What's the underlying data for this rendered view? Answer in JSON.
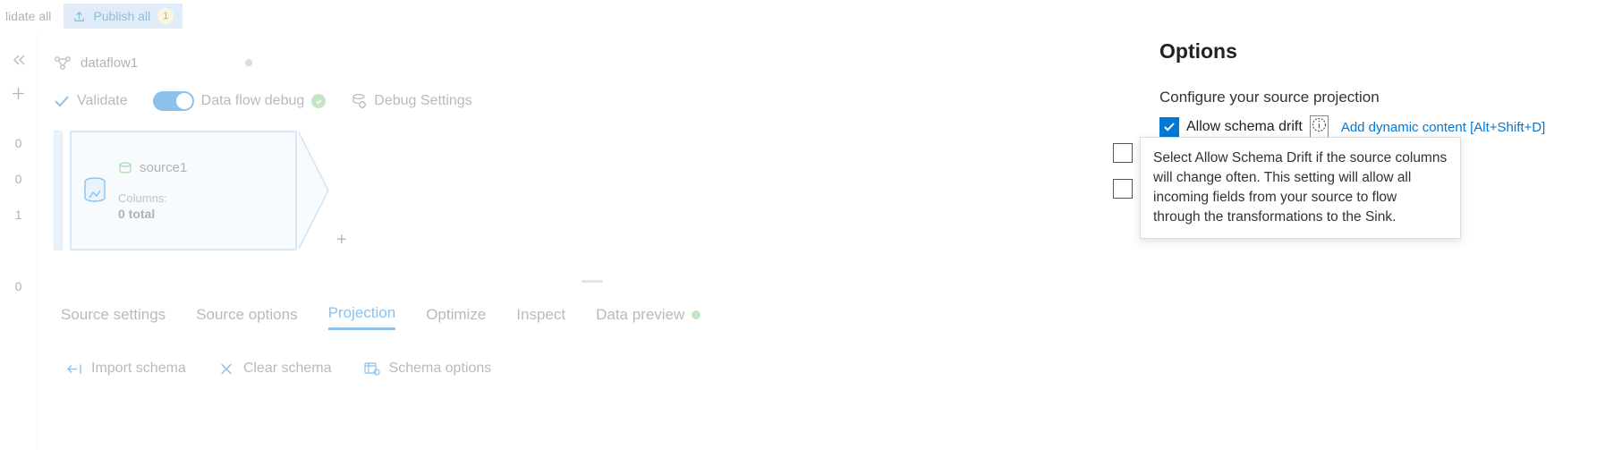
{
  "toolbar": {
    "validate_all": "lidate all",
    "publish_all": "Publish all",
    "publish_count": "1"
  },
  "flow": {
    "name": "dataflow1"
  },
  "actions": {
    "validate": "Validate",
    "debug_label": "Data flow debug",
    "debug_settings": "Debug Settings"
  },
  "node": {
    "name": "source1",
    "cols_label": "Columns:",
    "cols_total": "0 total"
  },
  "tabs": {
    "source_settings": "Source settings",
    "source_options": "Source options",
    "projection": "Projection",
    "optimize": "Optimize",
    "inspect": "Inspect",
    "data_preview": "Data preview"
  },
  "schema": {
    "import": "Import schema",
    "clear": "Clear schema",
    "options": "Schema options"
  },
  "rail": {
    "n1": "0",
    "n2": "0",
    "n3": "1",
    "n4": "0"
  },
  "panel": {
    "title": "Options",
    "subtitle": "Configure your source projection",
    "allow_schema_drift": "Allow schema drift",
    "dynamic_link": "Add dynamic content [Alt+Shift+D]",
    "tooltip": "Select Allow Schema Drift if the source columns will change often. This setting will allow all incoming fields from your source to flow through the transformations to the Sink."
  }
}
